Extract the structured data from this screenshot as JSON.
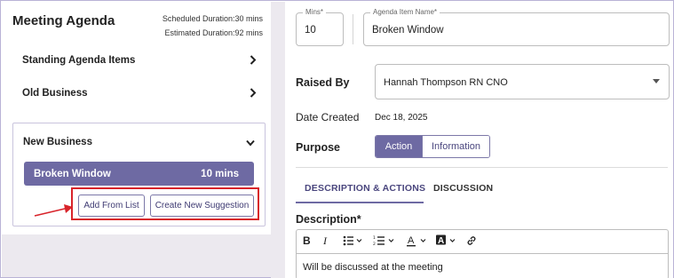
{
  "agenda": {
    "title": "Meeting Agenda",
    "scheduled_duration": "Scheduled Duration:30 mins",
    "estimated_duration": "Estimated Duration:92 mins",
    "sections": [
      {
        "label": "Standing Agenda Items",
        "icon": "chevron-right-icon"
      },
      {
        "label": "Old Business",
        "icon": "chevron-right-icon"
      }
    ],
    "new_business": {
      "label": "New Business",
      "icon": "chevron-down-icon",
      "item": {
        "label": "Broken Window",
        "duration": "10 mins"
      },
      "add_from_list": "Add From List",
      "create_new_suggestion": "Create New Suggestion"
    }
  },
  "form": {
    "mins": {
      "legend": "Mins*",
      "value": "10"
    },
    "item_name": {
      "legend": "Agenda Item Name*",
      "value": "Broken Window"
    },
    "raised_by": {
      "label": "Raised By",
      "value": "Hannah Thompson RN CNO"
    },
    "date_created": {
      "label": "Date Created",
      "value": "Dec 18, 2025"
    },
    "purpose": {
      "label": "Purpose",
      "options": [
        "Action",
        "Information"
      ],
      "selected": "Action"
    },
    "tabs": [
      "DESCRIPTION & ACTIONS",
      "DISCUSSION"
    ],
    "description": {
      "label": "Description*",
      "text": "Will be discussed at the meeting"
    }
  },
  "toolbar": {
    "bold": "B",
    "italic": "I",
    "icons": [
      "bold-icon",
      "italic-icon",
      "bullet-list-icon",
      "numbered-list-icon",
      "text-color-icon",
      "highlight-color-icon",
      "link-icon"
    ]
  },
  "colors": {
    "accent": "#6e6aa3",
    "highlight": "#d8232a",
    "panel_bg": "#ece9ef"
  }
}
